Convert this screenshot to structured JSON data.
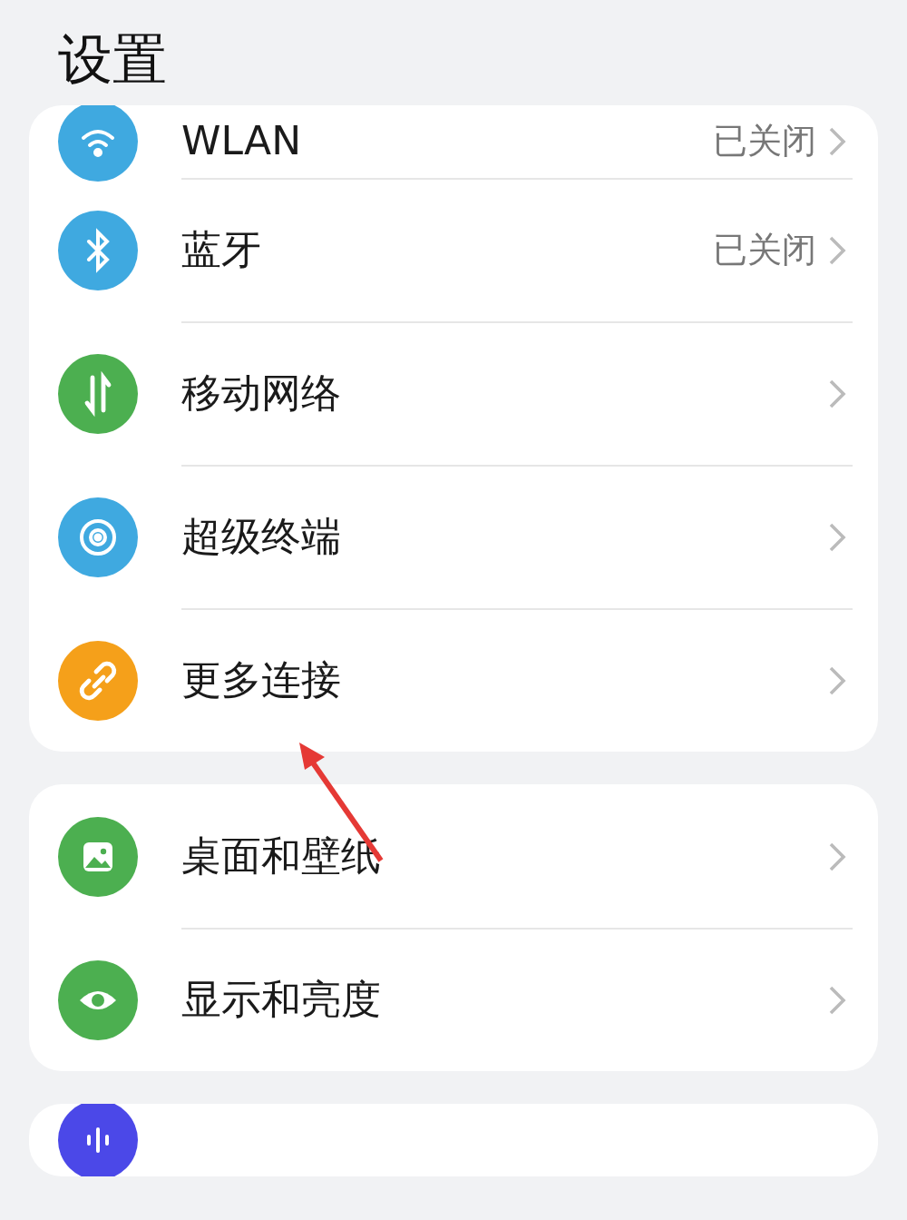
{
  "title": "设置",
  "groups": [
    {
      "items": [
        {
          "kind": "wifi",
          "color": "#3fa9e0",
          "label": "WLAN",
          "value": "已关闭",
          "partial": true
        },
        {
          "kind": "bluetooth",
          "color": "#3fa9e0",
          "label": "蓝牙",
          "value": "已关闭"
        },
        {
          "kind": "data",
          "color": "#4caf50",
          "label": "移动网络"
        },
        {
          "kind": "superdevice",
          "color": "#3fa9e0",
          "label": "超级终端"
        },
        {
          "kind": "link",
          "color": "#f5a01a",
          "label": "更多连接"
        }
      ]
    },
    {
      "items": [
        {
          "kind": "image",
          "color": "#4caf50",
          "label": "桌面和壁纸"
        },
        {
          "kind": "eye",
          "color": "#4caf50",
          "label": "显示和亮度"
        }
      ]
    },
    {
      "items": [
        {
          "kind": "sound",
          "color": "#4b48e8",
          "partial": true
        }
      ]
    }
  ],
  "annotation": {
    "kind": "arrow",
    "color": "#e53935"
  }
}
